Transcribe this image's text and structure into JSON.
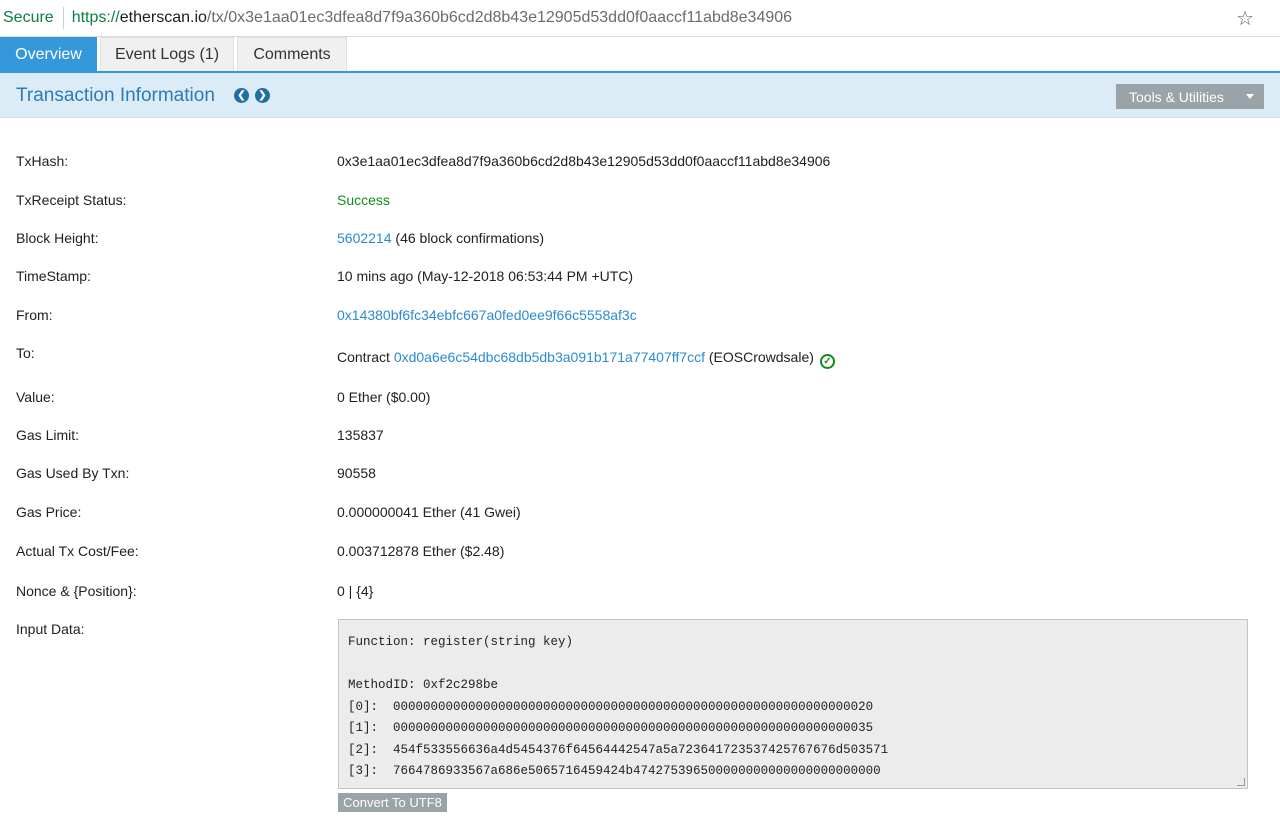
{
  "browser": {
    "secure_label": "Secure",
    "url_scheme": "https://",
    "url_host": "etherscan.io",
    "url_path": "/tx/0x3e1aa01ec3dfea8d7f9a360b6cd2d8b43e12905d53dd0f0aaccf11abd8e34906"
  },
  "tabs": [
    {
      "label": "Overview",
      "active": true
    },
    {
      "label": "Event Logs (1)",
      "active": false
    },
    {
      "label": "Comments",
      "active": false
    }
  ],
  "header": {
    "title": "Transaction Information",
    "tools_label": "Tools & Utilities"
  },
  "details": {
    "txhash": {
      "label": "TxHash:",
      "value": "0x3e1aa01ec3dfea8d7f9a360b6cd2d8b43e12905d53dd0f0aaccf11abd8e34906"
    },
    "status": {
      "label": "TxReceipt Status:",
      "value": "Success"
    },
    "block": {
      "label": "Block Height:",
      "value": "5602214",
      "suffix": "(46 block confirmations)"
    },
    "timestamp": {
      "label": "TimeStamp:",
      "value": "10 mins ago (May-12-2018 06:53:44 PM +UTC)"
    },
    "from": {
      "label": "From:",
      "value": "0x14380bf6fc34ebfc667a0fed0ee9f66c5558af3c"
    },
    "to": {
      "label": "To:",
      "prefix": "Contract",
      "value": "0xd0a6e6c54dbc68db5db3a091b171a77407ff7ccf",
      "suffix": "(EOSCrowdsale)"
    },
    "value": {
      "label": "Value:",
      "value": "0 Ether ($0.00)"
    },
    "gas_limit": {
      "label": "Gas Limit:",
      "value": "135837"
    },
    "gas_used": {
      "label": "Gas Used By Txn:",
      "value": "90558"
    },
    "gas_price": {
      "label": "Gas Price:",
      "value": "0.000000041 Ether (41 Gwei)"
    },
    "fee": {
      "label": "Actual Tx Cost/Fee:",
      "value": "0.003712878 Ether ($2.48)"
    },
    "nonce": {
      "label": "Nonce & {Position}:",
      "value": "0 | {4}"
    },
    "input": {
      "label": "Input Data:",
      "text": "Function: register(string key)\n\nMethodID: 0xf2c298be\n[0]:  0000000000000000000000000000000000000000000000000000000000000020\n[1]:  0000000000000000000000000000000000000000000000000000000000000035\n[2]:  454f533556636a4d5454376f64564442547a5a723641723537425767676d503571\n[3]:  7664786933567a686e5065716459424b474275396500000000000000000000000",
      "convert_label": "Convert To UTF8"
    }
  }
}
